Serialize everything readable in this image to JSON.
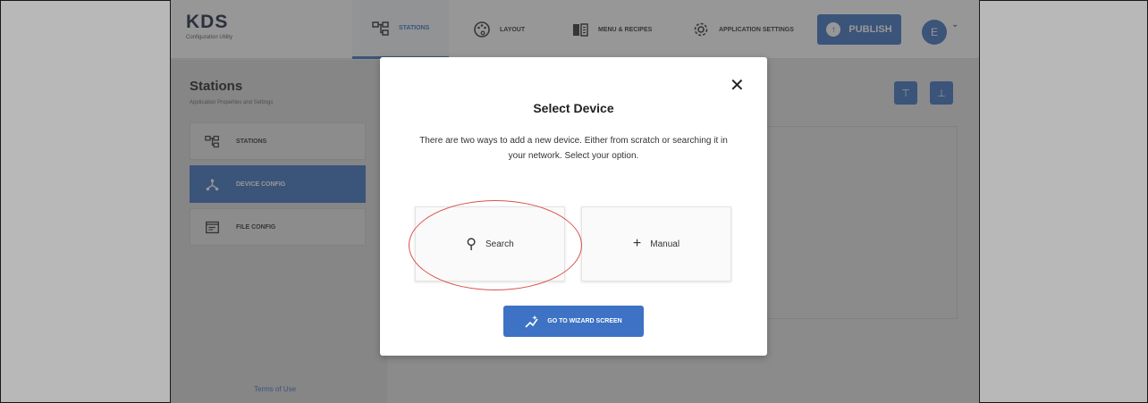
{
  "header": {
    "logo_title": "KDS",
    "logo_subtitle": "Configuration Utility",
    "tabs": [
      {
        "label": "STATIONS",
        "icon": "stations-icon",
        "active": true
      },
      {
        "label": "LAYOUT",
        "icon": "palette-icon",
        "active": false
      },
      {
        "label": "MENU & RECIPES",
        "icon": "book-icon",
        "active": false
      },
      {
        "label": "APPLICATION SETTINGS",
        "icon": "gear-icon",
        "active": false
      }
    ],
    "publish_label": "PUBLISH",
    "avatar_initial": "E"
  },
  "sidebar": {
    "title": "Stations",
    "subtitle": "Application Properties and Settings",
    "items": [
      {
        "label": "STATIONS",
        "icon": "stations-icon",
        "active": false
      },
      {
        "label": "DEVICE CONFIG",
        "icon": "network-icon",
        "active": true
      },
      {
        "label": "FILE CONFIG",
        "icon": "file-icon",
        "active": false
      }
    ],
    "terms_label": "Terms of Use"
  },
  "main": {
    "actions": [
      {
        "icon": "upload-icon",
        "glyph": "⊤"
      },
      {
        "icon": "download-icon",
        "glyph": "⊥"
      }
    ]
  },
  "modal": {
    "title": "Select Device",
    "description": "There are two ways to add a new device. Either from scratch or searching it in your network. Select your option.",
    "close_glyph": "✕",
    "options": [
      {
        "label": "Search",
        "glyph": "⚲",
        "icon": "search-icon"
      },
      {
        "label": "Manual",
        "glyph": "+",
        "icon": "plus-icon"
      }
    ],
    "wizard_label": "GO TO WIZARD SCREEN"
  },
  "colors": {
    "accent": "#3d72c4",
    "highlight": "#d9534f",
    "backdrop": "#e9e9ea"
  }
}
